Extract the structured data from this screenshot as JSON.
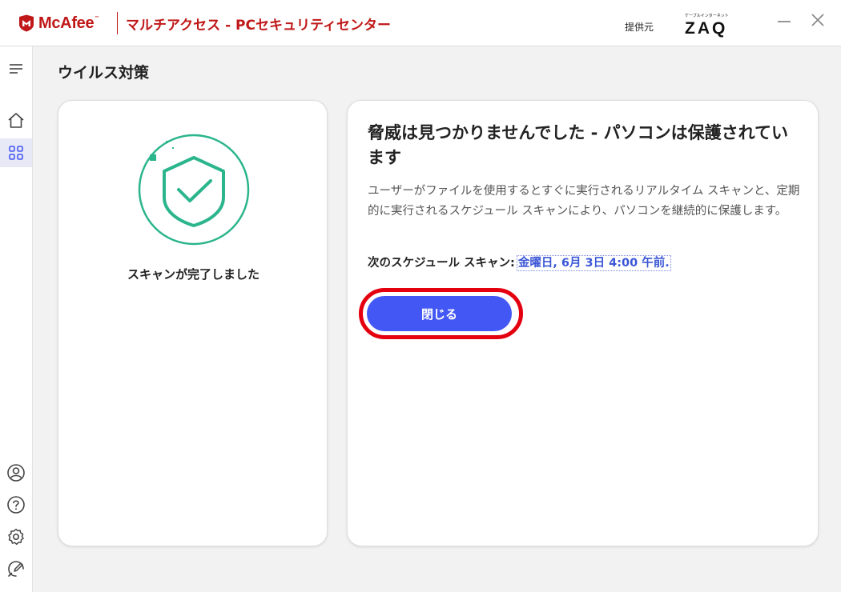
{
  "titlebar": {
    "brand": "McAfee",
    "brand_tm": "™",
    "app_title": "マルチアクセス - PCセキュリティセンター",
    "provider_label": "提供元",
    "provider_logo_sub": "ケーブルインターネット",
    "provider_logo_main": "ZAQ"
  },
  "page": {
    "title": "ウイルス対策"
  },
  "status_card": {
    "status_text": "スキャンが完了しました"
  },
  "result_card": {
    "heading": "脅威は見つかりませんでした - パソコンは保護されています",
    "description": "ユーザーがファイルを使用するとすぐに実行されるリアルタイム スキャンと、定期的に実行されるスケジュール スキャンにより、パソコンを継続的に保護します。",
    "schedule_label": "次のスケジュール スキャン:",
    "schedule_value": "金曜日, 6月 3日 4:00 午前.",
    "close_button": "閉じる"
  },
  "colors": {
    "brand_red": "#c01818",
    "accent_blue": "#4357f4",
    "success_green": "#2bb58c",
    "highlight_red": "#e4000f"
  },
  "icons": {
    "sidebar_top": "menu-icon",
    "sidebar_nav": [
      "home-icon",
      "apps-grid-icon"
    ],
    "sidebar_bottom": [
      "account-icon",
      "help-icon",
      "settings-icon",
      "feedback-icon"
    ]
  }
}
